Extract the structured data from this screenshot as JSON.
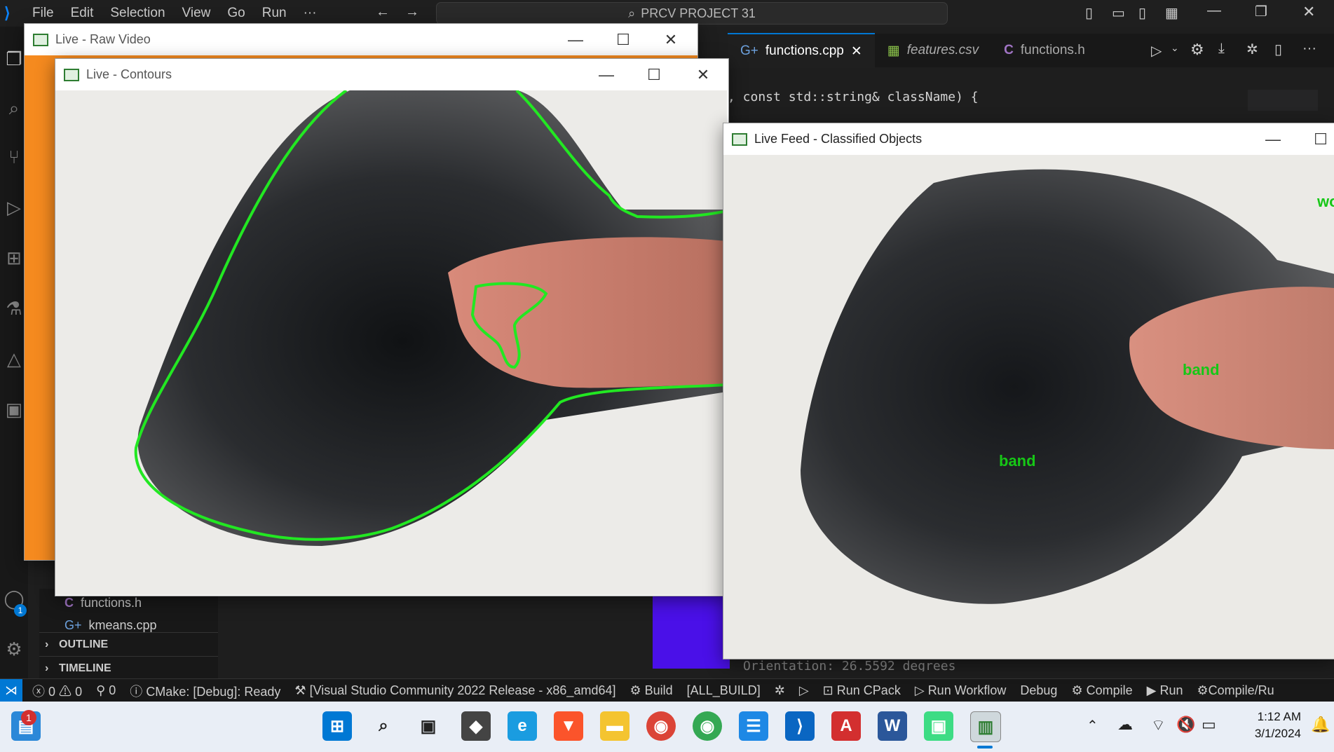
{
  "vscode": {
    "menu": [
      "File",
      "Edit",
      "Selection",
      "View",
      "Go",
      "Run",
      "···"
    ],
    "command_center": "PRCV PROJECT 31",
    "tabs": [
      {
        "label": "functions.cpp",
        "icon": "cpp-icon",
        "active": true
      },
      {
        "label": "features.csv",
        "icon": "csv-icon",
        "active": false
      },
      {
        "label": "functions.h",
        "icon": "c-header-icon",
        "active": false
      }
    ],
    "code_line": ", const std::string& className) {",
    "sidebar_files": [
      "functions.h",
      "kmeans.cpp"
    ],
    "sidebar_sections": [
      "OUTLINE",
      "TIMELINE"
    ],
    "behind_text": "Orientation: 26.5592 degrees"
  },
  "status": {
    "errors": "0",
    "warnings": "0",
    "ports": "0",
    "cmake": "CMake: [Debug]: Ready",
    "kit": "[Visual Studio Community 2022 Release - x86_amd64]",
    "build": "Build",
    "target": "[ALL_BUILD]",
    "cpack": "Run CPack",
    "workflow": "Run Workflow",
    "debug": "Debug",
    "compile": "Compile",
    "run": "Run",
    "compile_run": "Compile/Ru"
  },
  "windows": {
    "raw": {
      "title": "Live - Raw Video"
    },
    "contours": {
      "title": "Live - Contours"
    },
    "classified": {
      "title": "Live Feed - Classified Objects",
      "labels": [
        "band",
        "band",
        "wo"
      ]
    }
  },
  "taskbar": {
    "time": "1:12 AM",
    "date": "3/1/2024",
    "notification_badge": "1",
    "account_badge": "1"
  },
  "colors": {
    "contour": "#22e822",
    "label": "#16c716",
    "accent": "#0078d4",
    "orange_bg": "#f58a1f",
    "purple_bg": "#4a10e8"
  }
}
